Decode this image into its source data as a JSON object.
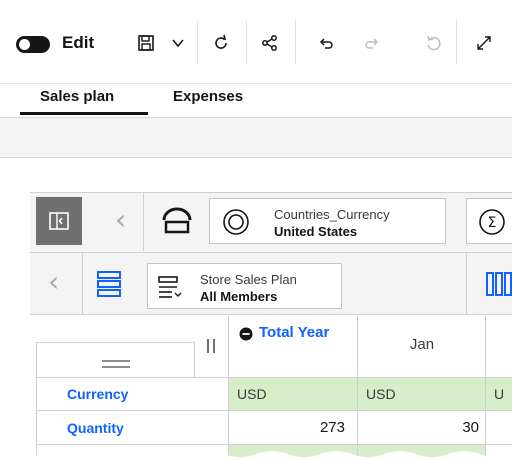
{
  "toolbar": {
    "edit_label": "Edit",
    "edit_toggle_on": true
  },
  "tabs": [
    {
      "label": "Sales plan",
      "active": true
    },
    {
      "label": "Expenses",
      "active": false
    }
  ],
  "context_bar": {
    "dimension_name": "Countries_Currency",
    "dimension_value": "United States"
  },
  "row_bar": {
    "dimension_name": "Store Sales Plan",
    "dimension_value": "All Members"
  },
  "table": {
    "columns": [
      {
        "label": "Total Year",
        "has_collapse": true
      },
      {
        "label": "Jan",
        "has_collapse": false
      }
    ],
    "rows": [
      {
        "label": "Currency",
        "values": [
          "USD",
          "USD",
          "U"
        ]
      },
      {
        "label": "Quantity",
        "values": [
          "273",
          "30",
          ""
        ]
      }
    ]
  },
  "colors": {
    "accent_blue": "#0f62fe",
    "cell_green": "#d7ecc9",
    "toggle_dark": "#161616"
  }
}
